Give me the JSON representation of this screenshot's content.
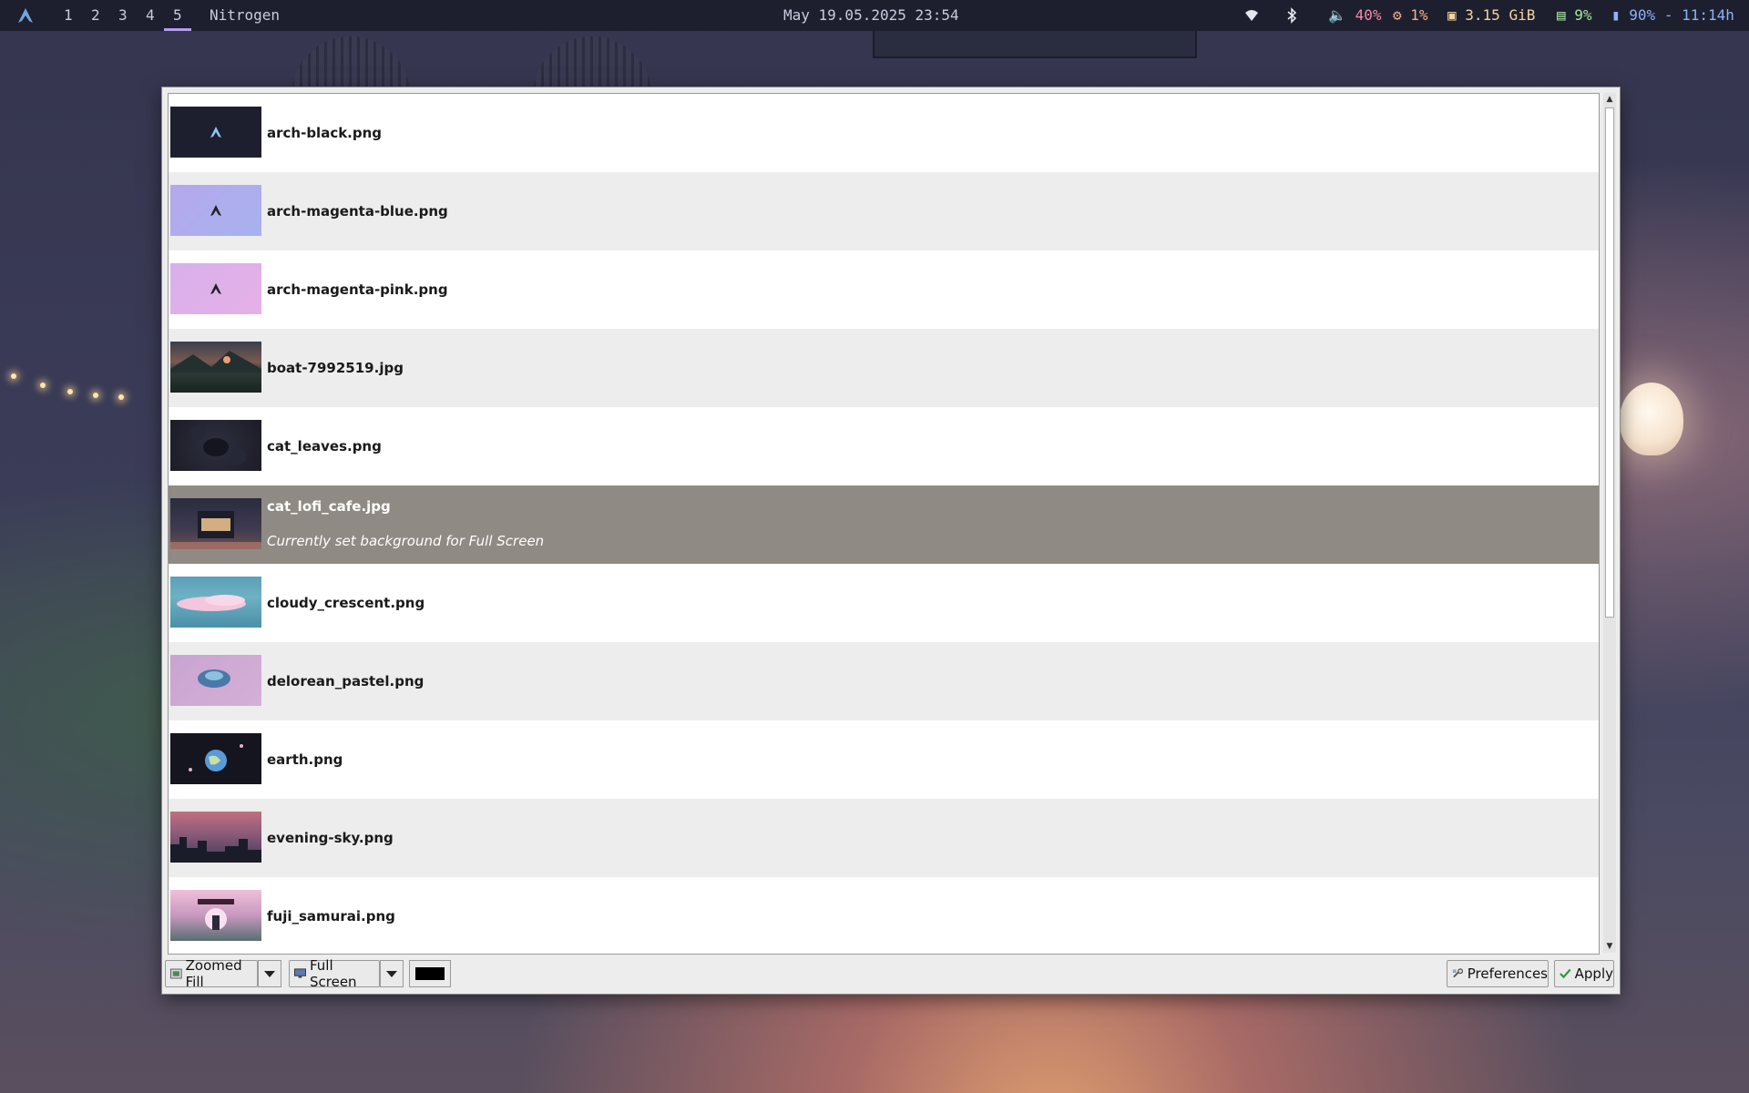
{
  "topbar": {
    "workspaces": [
      "1",
      "2",
      "3",
      "4",
      "5"
    ],
    "active_workspace": "5",
    "window_title": "Nitrogen",
    "datetime": "May 19.05.2025 23:54",
    "volume": "40%",
    "cpu": "1%",
    "memory": "3.15 GiB",
    "disk": "9%",
    "battery": "90% - 11:14h",
    "icons": [
      "arch-logo-icon",
      "wifi-icon",
      "bluetooth-icon",
      "volume-icon",
      "cpu-icon",
      "memory-icon",
      "disk-icon",
      "battery-icon"
    ]
  },
  "files": [
    {
      "name": "arch-black.png"
    },
    {
      "name": "arch-magenta-blue.png"
    },
    {
      "name": "arch-magenta-pink.png"
    },
    {
      "name": "boat-7992519.jpg"
    },
    {
      "name": "cat_leaves.png"
    },
    {
      "name": "cat_lofi_cafe.jpg",
      "note": "Currently set background for Full Screen",
      "selected": true
    },
    {
      "name": "cloudy_crescent.png"
    },
    {
      "name": "delorean_pastel.png"
    },
    {
      "name": "earth.png"
    },
    {
      "name": "evening-sky.png"
    },
    {
      "name": "fuji_samurai.png"
    }
  ],
  "controls": {
    "mode": "Zoomed Fill",
    "screen": "Full Screen",
    "bg_color": "#000000",
    "preferences_label": "Preferences",
    "apply_label": "Apply"
  },
  "colors": {
    "bar_bg": "#1e1f2e",
    "selected_row": "#8f8b84",
    "accent": "#b49cf0"
  }
}
